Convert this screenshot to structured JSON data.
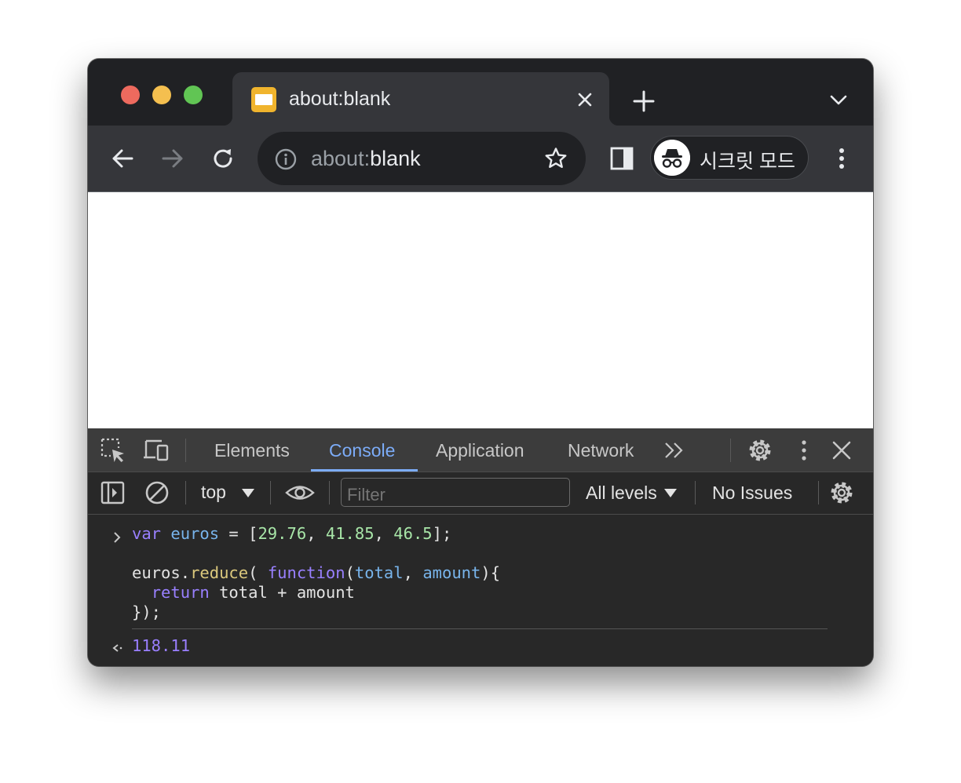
{
  "tab": {
    "title": "about:blank",
    "favicon": "blank-page-icon",
    "close_icon": "close-icon"
  },
  "tabstrip": {
    "new_tab_icon": "plus-icon",
    "tab_search_icon": "chevron-down-icon"
  },
  "toolbar": {
    "back_icon": "arrow-left-icon",
    "forward_icon": "arrow-right-icon",
    "reload_icon": "reload-icon",
    "url_scheme": "about:",
    "url_host": "blank",
    "site_info_icon": "info-icon",
    "bookmark_icon": "star-icon",
    "side_panel_icon": "side-panel-icon",
    "incognito_label": "시크릿 모드",
    "incognito_icon": "incognito-icon",
    "menu_icon": "more-vertical-icon"
  },
  "devtools": {
    "tabs": [
      "Elements",
      "Console",
      "Application",
      "Network"
    ],
    "active_tab": "Console",
    "accent_color": "#7cacf8",
    "overflow_icon": "double-chevron-right-icon",
    "context": "top",
    "filter_placeholder": "Filter",
    "levels": "All levels",
    "issues": "No Issues"
  },
  "console": {
    "input_lines": [
      "var euros = [29.76, 41.85, 46.5];",
      "",
      "euros.reduce( function(total, amount){",
      "  return total + amount",
      "});"
    ],
    "result": "118.11"
  }
}
